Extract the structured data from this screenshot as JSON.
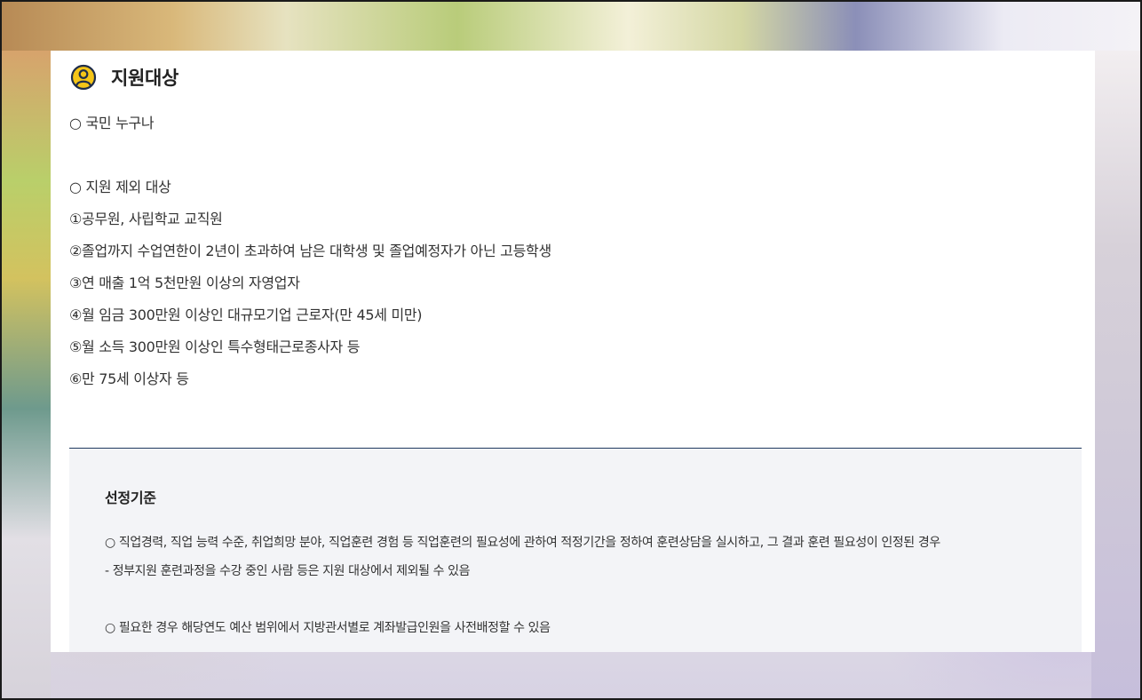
{
  "support": {
    "title": "지원대상",
    "items": [
      "○ 국민 누구나",
      "",
      "○ 지원 제외 대상",
      "①공무원, 사립학교 교직원",
      "②졸업까지 수업연한이 2년이 초과하여 남은 대학생 및 졸업예정자가 아닌 고등학생",
      "③연 매출 1억 5천만원 이상의 자영업자",
      "④월 임금 300만원 이상인 대규모기업 근로자(만 45세 미만)",
      "⑤월 소득 300만원 이상인 특수형태근로종사자 등",
      "⑥만 75세 이상자 등"
    ]
  },
  "criteria": {
    "title": "선정기준",
    "line1": "○ 직업경력, 직업 능력 수준, 취업희망 분야, 직업훈련 경험 등 직업훈련의 필요성에 관하여 적정기간을 정하여 훈련상담을 실시하고, 그 결과 훈련 필요성이 인정된 경우",
    "line2": "- 정부지원 훈련과정을 수강 중인 사람 등은 지원 대상에서 제외될 수 있음",
    "line3": "○ 필요한 경우 해당연도 예산 범위에서 지방관서별로 계좌발급인원을 사전배정할 수 있음"
  },
  "colors": {
    "icon_fill": "#f5c518",
    "icon_stroke": "#1f2d4a",
    "divider": "#1f3a5f",
    "criteria_bg": "#f3f4f7"
  }
}
